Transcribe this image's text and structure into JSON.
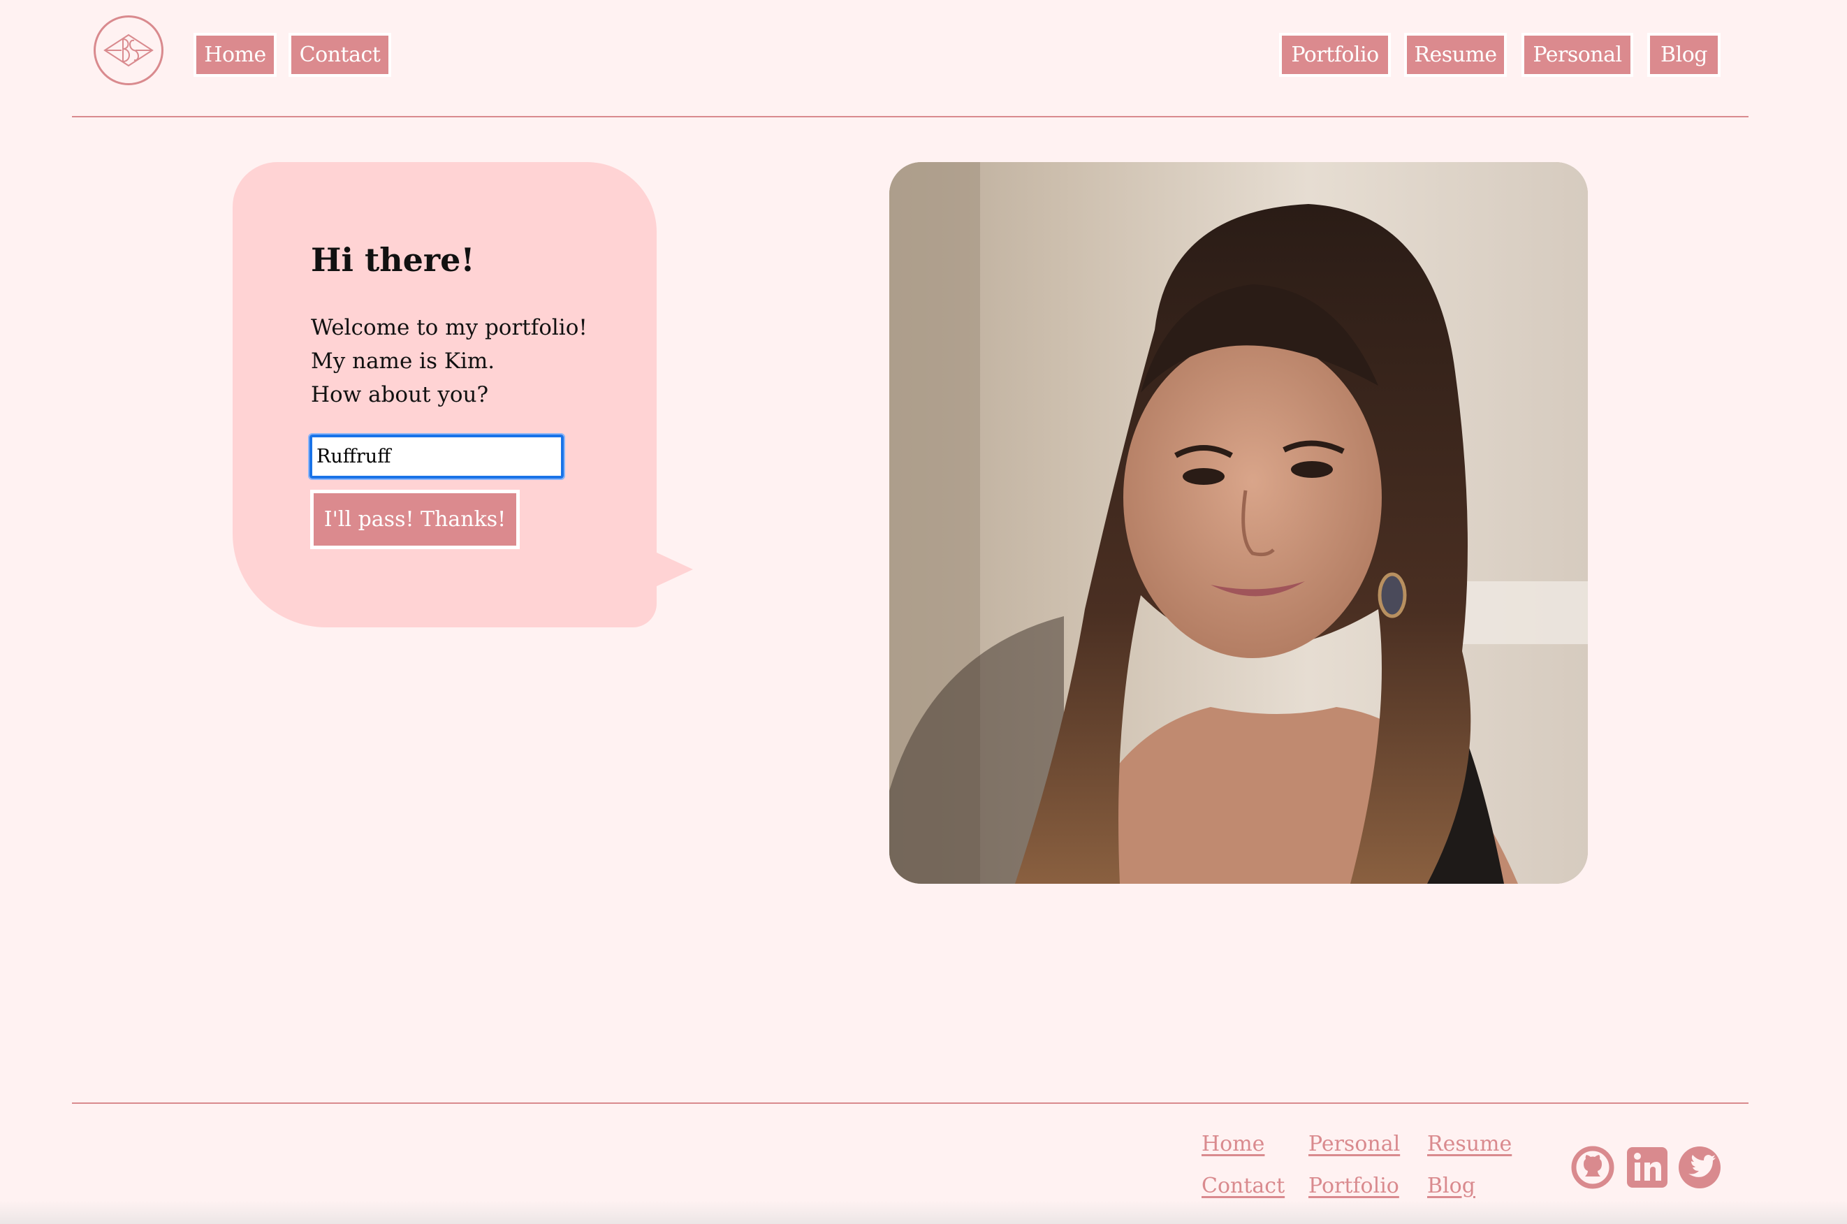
{
  "header": {
    "left_nav": [
      "Home",
      "Contact"
    ],
    "right_nav": [
      "Portfolio",
      "Resume",
      "Personal",
      "Blog"
    ]
  },
  "greeting": {
    "title": "Hi there!",
    "lines": [
      "Welcome to my portfolio!",
      "My name is Kim.",
      "How about you?"
    ],
    "name_input_value": "Ruffruff",
    "pass_button": "I'll pass! Thanks!"
  },
  "portrait": {
    "icon": "portrait-photo"
  },
  "footer": {
    "links": [
      "Home",
      "Personal",
      "Resume",
      "Contact",
      "Portfolio",
      "Blog"
    ],
    "social_icons": [
      "github-icon",
      "linkedin-icon",
      "twitter-icon"
    ]
  },
  "colors": {
    "background": "#fff2f2",
    "accent": "#db8a8e",
    "bubble": "#ffd3d4",
    "focus": "#1a73e8"
  }
}
